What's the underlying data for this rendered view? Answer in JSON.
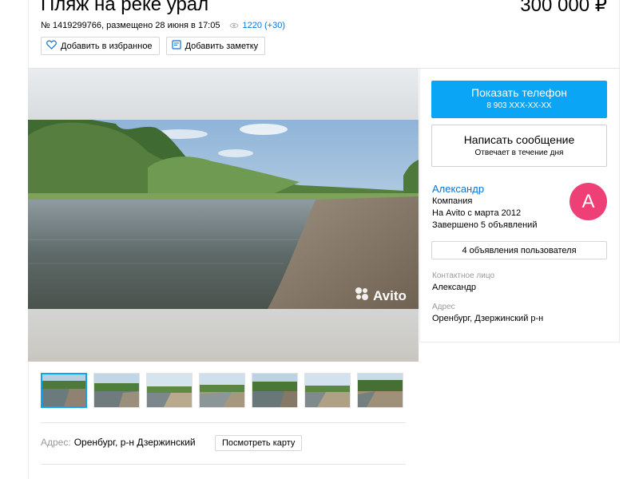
{
  "listing": {
    "title": "Пляж на реке урал",
    "price": "300 000 ₽",
    "meta": "№ 1419299766, размещено 28 июня в 17:05",
    "views": "1220 (+30)"
  },
  "actions": {
    "favorite_label": "Добавить в избранное",
    "note_label": "Добавить заметку"
  },
  "photo": {
    "watermark": "Avito"
  },
  "contact_panel": {
    "phone_label": "Показать телефон",
    "phone_masked": "8 903 XXX-XX-XX",
    "message_label": "Написать сообщение",
    "message_sub": "Отвечает в течение дня",
    "seller_name": "Александр",
    "seller_type": "Компания",
    "seller_since": "На Avito с марта 2012",
    "seller_completed": "Завершено 5 объявлений",
    "avatar_letter": "A",
    "user_ads_label": "4 объявления пользователя",
    "contact_person_label": "Контактное лицо",
    "contact_person": "Александр",
    "address_label": "Адрес",
    "address": "Оренбург, Дзержинский р-н"
  },
  "thumbnails_count": 7,
  "address_row": {
    "label": "Адрес:",
    "value": "Оренбург, р-н Дзержинский",
    "map_button": "Посмотреть карту"
  },
  "colors": {
    "accent": "#0aa5f5",
    "link": "#0a74d6",
    "avatar": "#ee3f76"
  }
}
